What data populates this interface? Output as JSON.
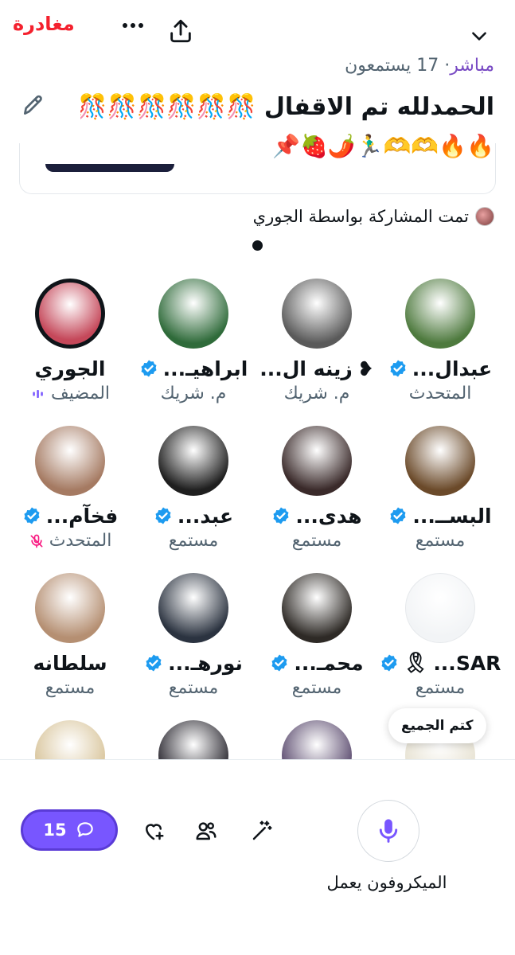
{
  "header": {
    "leave_label": "مغادرة",
    "live_label": "مباشر",
    "listeners_text": "17 يستمعون",
    "title": "الحمدلله تم الاقفال 🎊🎊🎊🎊🎊🎊",
    "emoji_line": "🔥🔥🫶🫶🏃‍♂️🌶️🍓📌",
    "shared_by": "تمت المشاركة بواسطة الجوري"
  },
  "participants": [
    {
      "name": "عبدال...",
      "role": "المتحدث",
      "verified": true,
      "avatar_color": "#4e7a3e"
    },
    {
      "name": "زينه ال...",
      "name_prefix": "❥",
      "role": "م. شريك",
      "verified": false,
      "avatar_color": "#5a5a5a"
    },
    {
      "name": "ابراهيـ...",
      "role": "م. شريك",
      "verified": true,
      "avatar_color": "#2f6b3a"
    },
    {
      "name": "الجوري",
      "role": "المضيف",
      "verified": false,
      "host": true,
      "avatar_color": "#c5485a"
    },
    {
      "name": "البســ...",
      "role": "مستمع",
      "verified": true,
      "avatar_color": "#6b4a2a"
    },
    {
      "name": "هدى...",
      "role": "مستمع",
      "verified": true,
      "avatar_color": "#3a2a2a"
    },
    {
      "name": "عبد...",
      "role": "مستمع",
      "verified": true,
      "avatar_color": "#1f1f1f"
    },
    {
      "name": "فخآم...",
      "role": "المتحدث",
      "verified": true,
      "muted": true,
      "avatar_color": "#a57a62"
    },
    {
      "name": "SAR...",
      "name_suffix": "🎗",
      "role": "مستمع",
      "verified": true,
      "avatar_color": "#f2f4f6"
    },
    {
      "name": "محمـ...",
      "role": "مستمع",
      "verified": true,
      "avatar_color": "#2e2a26"
    },
    {
      "name": "نورهـ...",
      "role": "مستمع",
      "verified": true,
      "avatar_color": "#2b3340"
    },
    {
      "name": "سلطانه",
      "role": "مستمع",
      "verified": false,
      "avatar_color": "#b58f72"
    },
    {
      "name": "",
      "role": "",
      "verified": false,
      "avatar_color": "#e7e2d2"
    },
    {
      "name": "",
      "role": "",
      "verified": false,
      "avatar_color": "#5a4a6e"
    },
    {
      "name": "",
      "role": "",
      "verified": false,
      "avatar_color": "#2a2830"
    },
    {
      "name": "",
      "role": "",
      "verified": false,
      "avatar_color": "#d8c49a"
    }
  ],
  "mute_all_label": "كتم الجميع",
  "bottom": {
    "comments_count": "15",
    "mic_label": "الميكروفون يعمل"
  },
  "colors": {
    "accent": "#7856ff",
    "leave": "#f4212e",
    "live": "#794bc4",
    "verified": "#1d9bf0"
  }
}
